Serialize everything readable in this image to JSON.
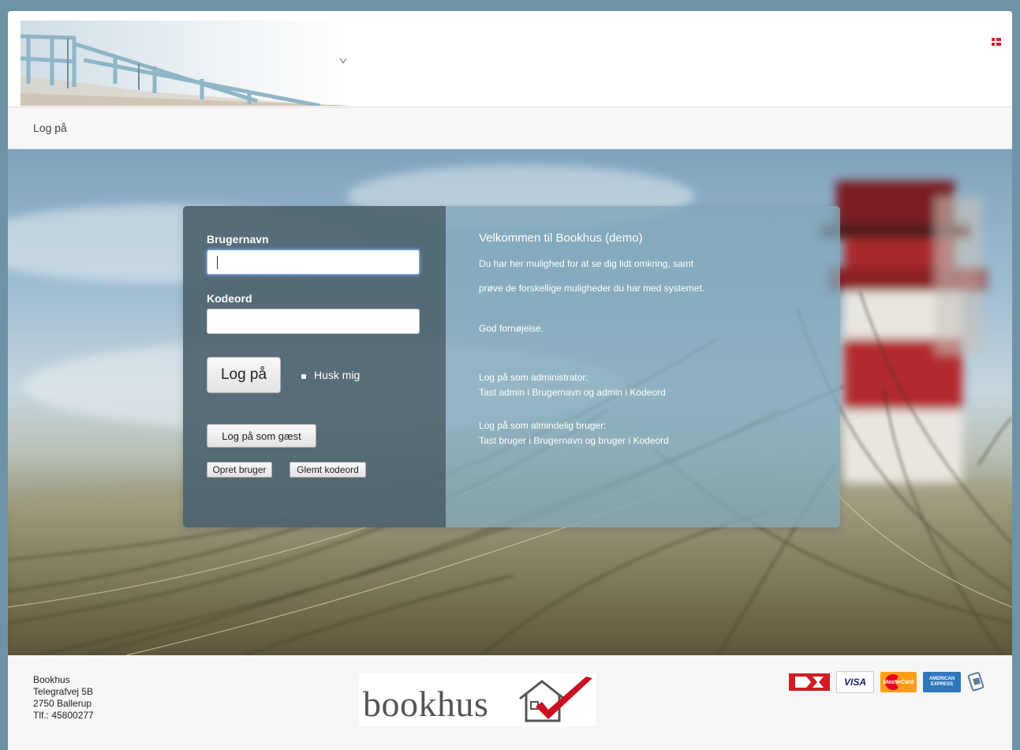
{
  "header": {
    "language_flag": "danish-flag-icon"
  },
  "breadcrumb": {
    "label": "Log på"
  },
  "login": {
    "username_label": "Brugernavn",
    "username_value": "",
    "password_label": "Kodeord",
    "password_value": "",
    "login_button": "Log på",
    "remember_label": "Husk mig",
    "guest_button": "Log på som gæst",
    "create_user_button": "Opret bruger",
    "forgot_password_button": "Glemt kodeord"
  },
  "welcome": {
    "title": "Velkommen til Bookhus (demo)",
    "line1": "Du har her mulighed for at se dig lidt omkring, samt",
    "line2": "prøve de forskellige muligheder du har med systemet.",
    "greeting": "God fornøjelse.",
    "admin_heading": "Log på som administrator:",
    "admin_text": "Tast admin i Brugernavn og admin i Kodeord",
    "user_heading": "Log på som almindelig bruger:",
    "user_text": "Tast bruger i Brugernavn og bruger i Kodeord"
  },
  "footer": {
    "company": "Bookhus",
    "street": "Telegrafvej 5B",
    "city": "2750 Ballerup",
    "phone": "Tlf.: 45800277",
    "logo_text": "bookhus",
    "payment_visa": "VISA",
    "payment_mastercard": "MasterCard",
    "payment_amex": "AMERICAN EXPRESS"
  },
  "colors": {
    "frame_bg": "#6e93a6",
    "card_left": "#4e6470",
    "card_right": "#80a8ba",
    "logo_check": "#cc1020",
    "flag_red": "#d91e2a"
  }
}
